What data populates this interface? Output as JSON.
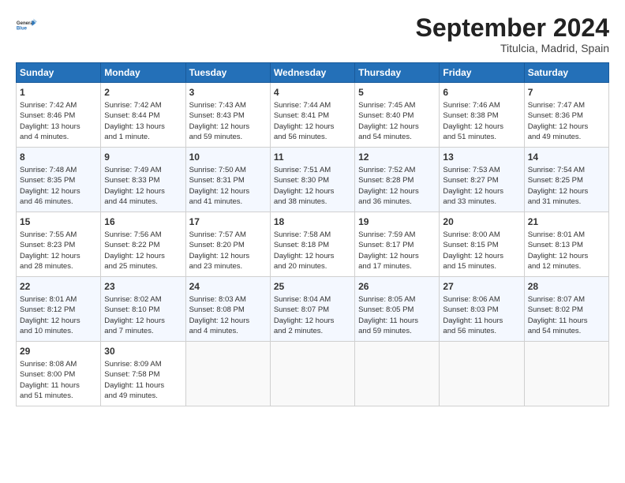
{
  "header": {
    "logo_line1": "General",
    "logo_line2": "Blue",
    "month": "September 2024",
    "location": "Titulcia, Madrid, Spain"
  },
  "days_of_week": [
    "Sunday",
    "Monday",
    "Tuesday",
    "Wednesday",
    "Thursday",
    "Friday",
    "Saturday"
  ],
  "weeks": [
    [
      {
        "day": "1",
        "lines": [
          "Sunrise: 7:42 AM",
          "Sunset: 8:46 PM",
          "Daylight: 13 hours",
          "and 4 minutes."
        ]
      },
      {
        "day": "2",
        "lines": [
          "Sunrise: 7:42 AM",
          "Sunset: 8:44 PM",
          "Daylight: 13 hours",
          "and 1 minute."
        ]
      },
      {
        "day": "3",
        "lines": [
          "Sunrise: 7:43 AM",
          "Sunset: 8:43 PM",
          "Daylight: 12 hours",
          "and 59 minutes."
        ]
      },
      {
        "day": "4",
        "lines": [
          "Sunrise: 7:44 AM",
          "Sunset: 8:41 PM",
          "Daylight: 12 hours",
          "and 56 minutes."
        ]
      },
      {
        "day": "5",
        "lines": [
          "Sunrise: 7:45 AM",
          "Sunset: 8:40 PM",
          "Daylight: 12 hours",
          "and 54 minutes."
        ]
      },
      {
        "day": "6",
        "lines": [
          "Sunrise: 7:46 AM",
          "Sunset: 8:38 PM",
          "Daylight: 12 hours",
          "and 51 minutes."
        ]
      },
      {
        "day": "7",
        "lines": [
          "Sunrise: 7:47 AM",
          "Sunset: 8:36 PM",
          "Daylight: 12 hours",
          "and 49 minutes."
        ]
      }
    ],
    [
      {
        "day": "8",
        "lines": [
          "Sunrise: 7:48 AM",
          "Sunset: 8:35 PM",
          "Daylight: 12 hours",
          "and 46 minutes."
        ]
      },
      {
        "day": "9",
        "lines": [
          "Sunrise: 7:49 AM",
          "Sunset: 8:33 PM",
          "Daylight: 12 hours",
          "and 44 minutes."
        ]
      },
      {
        "day": "10",
        "lines": [
          "Sunrise: 7:50 AM",
          "Sunset: 8:31 PM",
          "Daylight: 12 hours",
          "and 41 minutes."
        ]
      },
      {
        "day": "11",
        "lines": [
          "Sunrise: 7:51 AM",
          "Sunset: 8:30 PM",
          "Daylight: 12 hours",
          "and 38 minutes."
        ]
      },
      {
        "day": "12",
        "lines": [
          "Sunrise: 7:52 AM",
          "Sunset: 8:28 PM",
          "Daylight: 12 hours",
          "and 36 minutes."
        ]
      },
      {
        "day": "13",
        "lines": [
          "Sunrise: 7:53 AM",
          "Sunset: 8:27 PM",
          "Daylight: 12 hours",
          "and 33 minutes."
        ]
      },
      {
        "day": "14",
        "lines": [
          "Sunrise: 7:54 AM",
          "Sunset: 8:25 PM",
          "Daylight: 12 hours",
          "and 31 minutes."
        ]
      }
    ],
    [
      {
        "day": "15",
        "lines": [
          "Sunrise: 7:55 AM",
          "Sunset: 8:23 PM",
          "Daylight: 12 hours",
          "and 28 minutes."
        ]
      },
      {
        "day": "16",
        "lines": [
          "Sunrise: 7:56 AM",
          "Sunset: 8:22 PM",
          "Daylight: 12 hours",
          "and 25 minutes."
        ]
      },
      {
        "day": "17",
        "lines": [
          "Sunrise: 7:57 AM",
          "Sunset: 8:20 PM",
          "Daylight: 12 hours",
          "and 23 minutes."
        ]
      },
      {
        "day": "18",
        "lines": [
          "Sunrise: 7:58 AM",
          "Sunset: 8:18 PM",
          "Daylight: 12 hours",
          "and 20 minutes."
        ]
      },
      {
        "day": "19",
        "lines": [
          "Sunrise: 7:59 AM",
          "Sunset: 8:17 PM",
          "Daylight: 12 hours",
          "and 17 minutes."
        ]
      },
      {
        "day": "20",
        "lines": [
          "Sunrise: 8:00 AM",
          "Sunset: 8:15 PM",
          "Daylight: 12 hours",
          "and 15 minutes."
        ]
      },
      {
        "day": "21",
        "lines": [
          "Sunrise: 8:01 AM",
          "Sunset: 8:13 PM",
          "Daylight: 12 hours",
          "and 12 minutes."
        ]
      }
    ],
    [
      {
        "day": "22",
        "lines": [
          "Sunrise: 8:01 AM",
          "Sunset: 8:12 PM",
          "Daylight: 12 hours",
          "and 10 minutes."
        ]
      },
      {
        "day": "23",
        "lines": [
          "Sunrise: 8:02 AM",
          "Sunset: 8:10 PM",
          "Daylight: 12 hours",
          "and 7 minutes."
        ]
      },
      {
        "day": "24",
        "lines": [
          "Sunrise: 8:03 AM",
          "Sunset: 8:08 PM",
          "Daylight: 12 hours",
          "and 4 minutes."
        ]
      },
      {
        "day": "25",
        "lines": [
          "Sunrise: 8:04 AM",
          "Sunset: 8:07 PM",
          "Daylight: 12 hours",
          "and 2 minutes."
        ]
      },
      {
        "day": "26",
        "lines": [
          "Sunrise: 8:05 AM",
          "Sunset: 8:05 PM",
          "Daylight: 11 hours",
          "and 59 minutes."
        ]
      },
      {
        "day": "27",
        "lines": [
          "Sunrise: 8:06 AM",
          "Sunset: 8:03 PM",
          "Daylight: 11 hours",
          "and 56 minutes."
        ]
      },
      {
        "day": "28",
        "lines": [
          "Sunrise: 8:07 AM",
          "Sunset: 8:02 PM",
          "Daylight: 11 hours",
          "and 54 minutes."
        ]
      }
    ],
    [
      {
        "day": "29",
        "lines": [
          "Sunrise: 8:08 AM",
          "Sunset: 8:00 PM",
          "Daylight: 11 hours",
          "and 51 minutes."
        ]
      },
      {
        "day": "30",
        "lines": [
          "Sunrise: 8:09 AM",
          "Sunset: 7:58 PM",
          "Daylight: 11 hours",
          "and 49 minutes."
        ]
      },
      {
        "day": "",
        "lines": []
      },
      {
        "day": "",
        "lines": []
      },
      {
        "day": "",
        "lines": []
      },
      {
        "day": "",
        "lines": []
      },
      {
        "day": "",
        "lines": []
      }
    ]
  ]
}
